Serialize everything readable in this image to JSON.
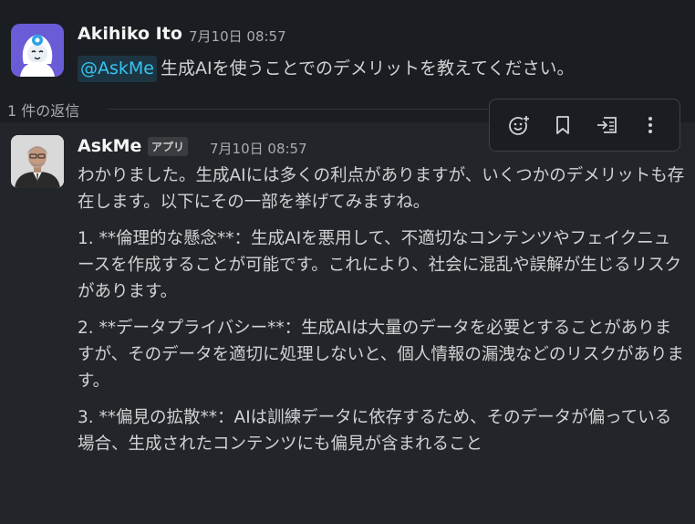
{
  "message1": {
    "author": "Akihiko Ito",
    "timestamp": "7月10日 08:57",
    "mention": "@AskMe",
    "text": "生成AIを使うことでのデメリットを教えてください。"
  },
  "thread": {
    "reply_count": "1 件の返信"
  },
  "message2": {
    "author": "AskMe",
    "badge": "アプリ",
    "timestamp": "7月10日 08:57",
    "paragraphs": [
      "わかりました。生成AIには多くの利点がありますが、いくつかのデメリットも存在します。以下にその一部を挙げてみますね。",
      "1. **倫理的な懸念**：生成AIを悪用して、不適切なコンテンツやフェイクニュースを作成することが可能です。これにより、社会に混乱や誤解が生じるリスクがあります。",
      "2. **データプライバシー**：生成AIは大量のデータを必要とすることがありますが、そのデータを適切に処理しないと、個人情報の漏洩などのリスクがあります。",
      "3. **偏見の拡散**：AIは訓練データに依存するため、そのデータが偏っている場合、生成されたコンテンツにも偏見が含まれること"
    ]
  },
  "toolbar": {
    "icons": [
      "add-reaction-icon",
      "bookmark-icon",
      "forward-to-list-icon",
      "more-actions-icon"
    ]
  },
  "colors": {
    "background": "#1a1d21",
    "hover_background": "#222529",
    "mention_text": "#36c5f0",
    "mention_bg": "#1d3543",
    "avatar1_bg": "#6a5bd6"
  }
}
